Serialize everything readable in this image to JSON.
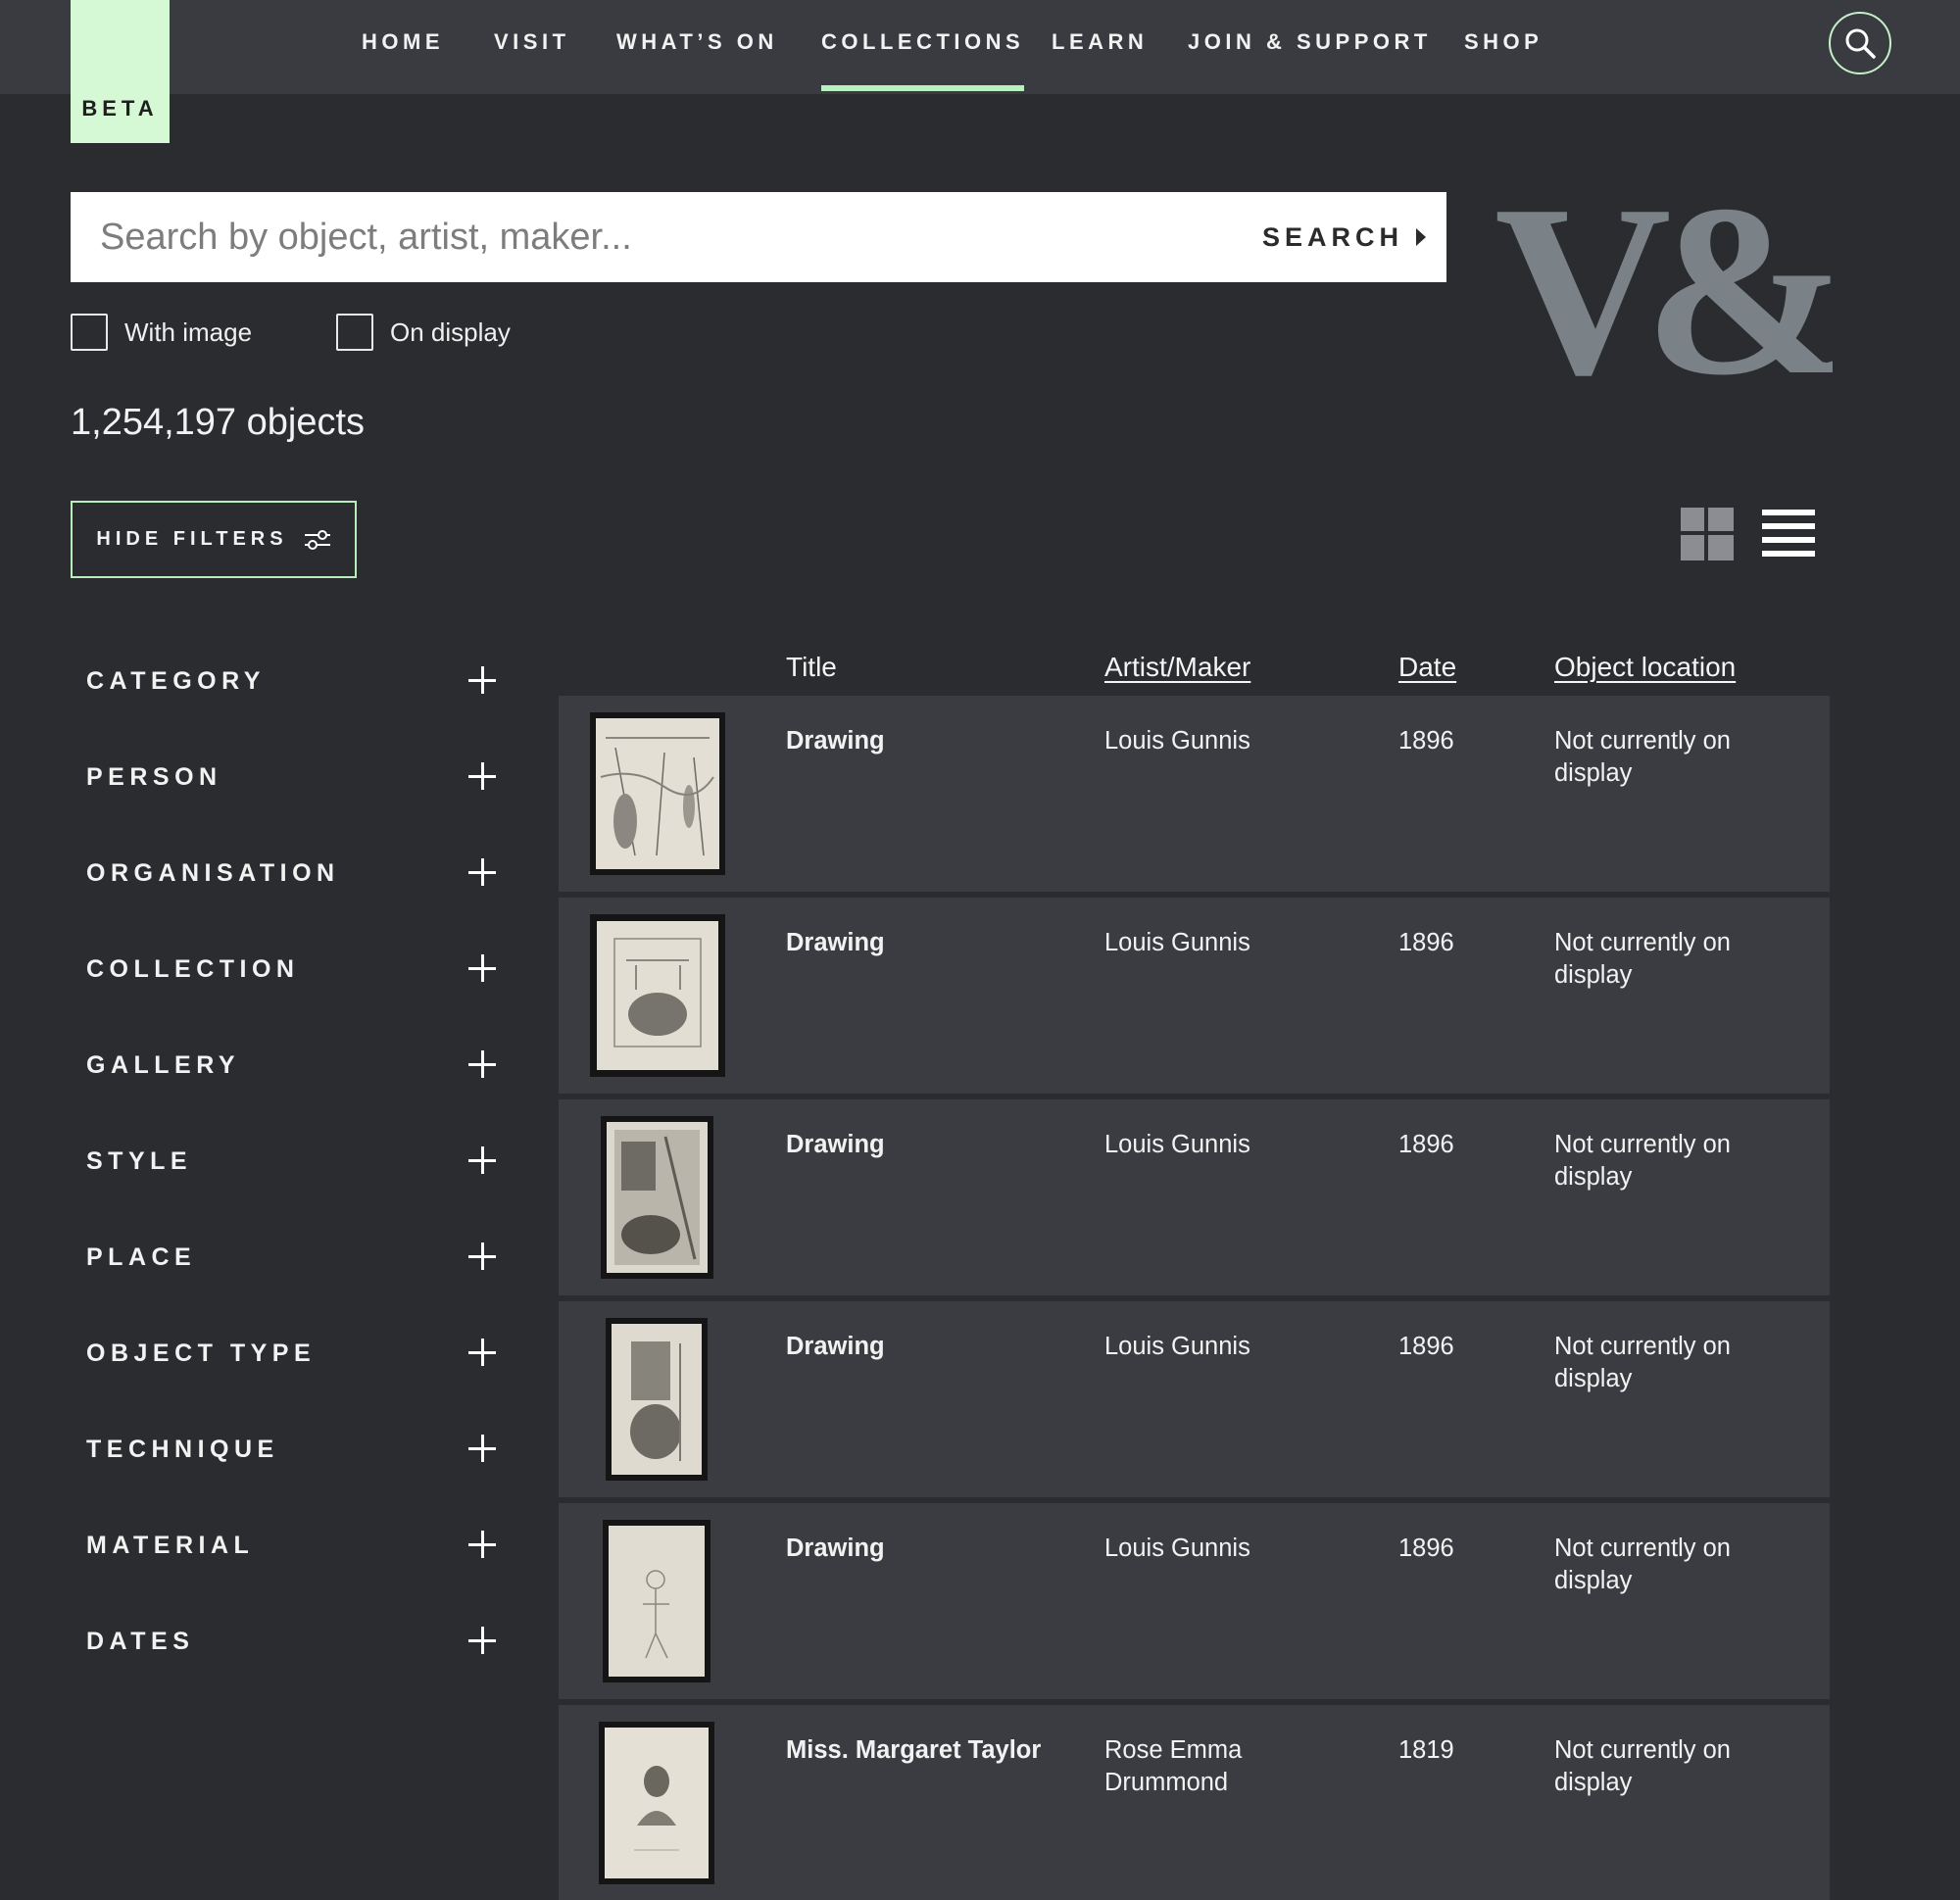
{
  "beta_label": "BETA",
  "nav": [
    "HOME",
    "VISIT",
    "WHAT’S ON",
    "COLLECTIONS",
    "LEARN",
    "JOIN & SUPPORT",
    "SHOP"
  ],
  "nav_active": "COLLECTIONS",
  "search": {
    "placeholder": "Search by object, artist, maker...",
    "value": "",
    "button_label": "SEARCH"
  },
  "logo_text": "V&A",
  "checkboxes": [
    {
      "label": "With image",
      "checked": false
    },
    {
      "label": "On display",
      "checked": false
    }
  ],
  "result_count": "1,254,197 objects",
  "hide_filters_label": "HIDE FILTERS",
  "filters": [
    "CATEGORY",
    "PERSON",
    "ORGANISATION",
    "COLLECTION",
    "GALLERY",
    "STYLE",
    "PLACE",
    "OBJECT TYPE",
    "TECHNIQUE",
    "MATERIAL",
    "DATES"
  ],
  "table": {
    "headers": {
      "title": "Title",
      "artist": "Artist/Maker",
      "date": "Date",
      "location": "Object location"
    },
    "rows": [
      {
        "title": "Drawing",
        "artist": "Louis Gunnis",
        "date": "1896",
        "location": "Not currently on display"
      },
      {
        "title": "Drawing",
        "artist": "Louis Gunnis",
        "date": "1896",
        "location": "Not currently on display"
      },
      {
        "title": "Drawing",
        "artist": "Louis Gunnis",
        "date": "1896",
        "location": "Not currently on display"
      },
      {
        "title": "Drawing",
        "artist": "Louis Gunnis",
        "date": "1896",
        "location": "Not currently on display"
      },
      {
        "title": "Drawing",
        "artist": "Louis Gunnis",
        "date": "1896",
        "location": "Not currently on display"
      },
      {
        "title": "Miss. Margaret Taylor",
        "artist": "Rose Emma Drummond",
        "date": "1819",
        "location": "Not currently on display"
      }
    ]
  },
  "colors": {
    "page_bg": "#2b2c30",
    "topbar_bg": "#3a3b40",
    "accent_green": "#b8f0c0",
    "beta_bg": "#d4f9d4",
    "row_bg": "#3b3c42",
    "logo_grey": "#7a8287"
  },
  "icons": {
    "search": "search-icon",
    "search_button_arrow": "caret-right-icon",
    "filters": "sliders-icon",
    "grid_view": "grid-view-icon",
    "list_view": "list-view-icon",
    "filter_expand": "plus-icon"
  }
}
